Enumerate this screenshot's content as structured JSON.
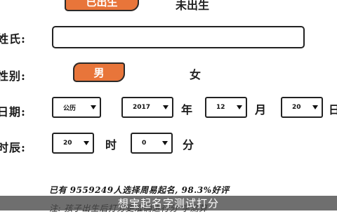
{
  "status": {
    "option_born": "已出生",
    "option_unborn": "未出生"
  },
  "surname": {
    "label": "姓氏:",
    "value": ""
  },
  "gender": {
    "label": "性别:",
    "option_male": "男",
    "option_female": "女"
  },
  "birthdate": {
    "label": "日期:",
    "calendar": "公历",
    "year": "2017",
    "year_unit": "年",
    "month": "12",
    "month_unit": "月",
    "day": "20",
    "day_unit": "日"
  },
  "birthtime": {
    "label": "时辰:",
    "hour": "20",
    "hour_unit": "时",
    "minute": "0",
    "minute_unit": "分"
  },
  "stats_text": "已有 9559249人选择周易起名, 98.3%好评",
  "note_text": "注: 孩子出生后打分更准确进行分 字测算",
  "banner_text": "想宝起名字测试打分",
  "colors": {
    "accent": "#e8753a",
    "banner": "#464646"
  }
}
